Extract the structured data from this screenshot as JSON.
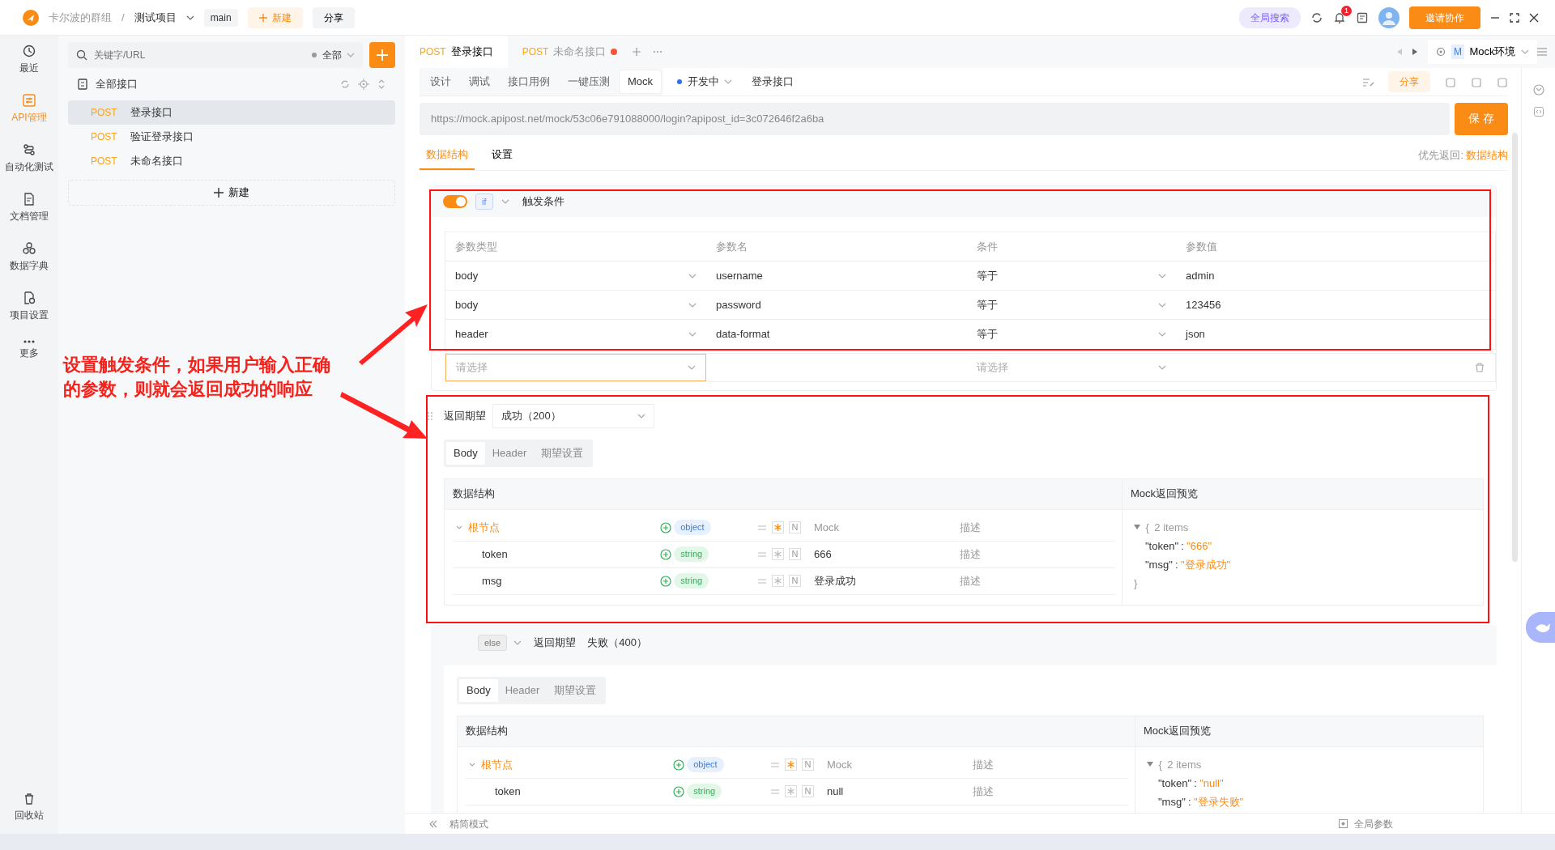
{
  "topbar": {
    "team": "卡尔波的群组",
    "separator": "/",
    "project": "测试项目",
    "branch": "main",
    "new_button": "新建",
    "share_button": "分享",
    "global_search": "全局搜索",
    "notification_count": "1",
    "invite_button": "邀请协作"
  },
  "rail": [
    {
      "label": "最近",
      "selected": false
    },
    {
      "label": "API管理",
      "selected": true
    },
    {
      "label": "自动化测试",
      "selected": false
    },
    {
      "label": "文档管理",
      "selected": false
    },
    {
      "label": "数据字典",
      "selected": false
    },
    {
      "label": "项目设置",
      "selected": false
    },
    {
      "label": "更多",
      "selected": false
    }
  ],
  "rail_bottom": {
    "label": "回收站"
  },
  "api_list": {
    "search_placeholder": "关键字/URL",
    "filter": "全部",
    "root": "全部接口",
    "new_button": "新建",
    "items": [
      {
        "method": "POST",
        "name": "登录接口",
        "selected": true
      },
      {
        "method": "POST",
        "name": "验证登录接口",
        "selected": false
      },
      {
        "method": "POST",
        "name": "未命名接口",
        "selected": false
      }
    ]
  },
  "tabs": [
    {
      "method": "POST",
      "name": "登录接口",
      "selected": true,
      "unsaved": false
    },
    {
      "method": "POST",
      "name": "未命名接口",
      "selected": false,
      "unsaved": true
    }
  ],
  "environment": {
    "badge": "M",
    "name": "Mock环境"
  },
  "subtabs": [
    {
      "label": "设计",
      "selected": false
    },
    {
      "label": "调试",
      "selected": false
    },
    {
      "label": "接口用例",
      "selected": false
    },
    {
      "label": "一键压测",
      "selected": false
    },
    {
      "label": "Mock",
      "selected": true
    }
  ],
  "status": "开发中",
  "api_name": "登录接口",
  "share": "分享",
  "url": "https://mock.apipost.net/mock/53c06e791088000/login?apipost_id=3c072646f2a6ba",
  "save_button": "保 存",
  "section_tabs": [
    {
      "label": "数据结构",
      "selected": true
    },
    {
      "label": "设置",
      "selected": false
    }
  ],
  "priority": {
    "label": "优先返回:",
    "value": "数据结构"
  },
  "condition": {
    "enabled": true,
    "keyword": "if",
    "title": "触发条件",
    "columns": [
      "参数类型",
      "参数名",
      "条件",
      "参数值"
    ],
    "rows": [
      {
        "type": "body",
        "name": "username",
        "operator": "等于",
        "value": "admin"
      },
      {
        "type": "body",
        "name": "password",
        "operator": "等于",
        "value": "123456"
      },
      {
        "type": "header",
        "name": "data-format",
        "operator": "等于",
        "value": "json"
      }
    ],
    "new_row": {
      "type_placeholder": "请选择",
      "operator_placeholder": "请选择"
    }
  },
  "expectations": [
    {
      "kind": "select",
      "label": "返回期望",
      "value": "成功（200）",
      "body_tabs": [
        {
          "label": "Body",
          "selected": true
        },
        {
          "label": "Header",
          "selected": false
        },
        {
          "label": "期望设置",
          "selected": false
        }
      ],
      "structure_title": "数据结构",
      "preview_title": "Mock返回预览",
      "fields": [
        {
          "name": "根节点",
          "type": "object",
          "required": true,
          "null_toggle": "N",
          "mock_placeholder": "Mock",
          "description_placeholder": "描述",
          "children": [
            {
              "name": "token",
              "type": "string",
              "required": false,
              "null_toggle": "N",
              "mock": "666",
              "description_placeholder": "描述"
            },
            {
              "name": "msg",
              "type": "string",
              "required": false,
              "null_toggle": "N",
              "mock": "登录成功",
              "description_placeholder": "描述"
            }
          ]
        }
      ],
      "preview": {
        "open": "{",
        "count": "2 items",
        "entries": [
          {
            "key": "\"token\"",
            "colon": ":",
            "value": "\"666\""
          },
          {
            "key": "\"msg\"",
            "colon": ":",
            "value": "\"登录成功\""
          }
        ],
        "close": "}"
      }
    },
    {
      "kind": "text",
      "keyword": "else",
      "label": "返回期望",
      "value": "失败（400）",
      "body_tabs": [
        {
          "label": "Body",
          "selected": true
        },
        {
          "label": "Header",
          "selected": false
        },
        {
          "label": "期望设置",
          "selected": false
        }
      ],
      "structure_title": "数据结构",
      "preview_title": "Mock返回预览",
      "fields": [
        {
          "name": "根节点",
          "type": "object",
          "required": true,
          "null_toggle": "N",
          "mock_placeholder": "Mock",
          "description_placeholder": "描述",
          "children": [
            {
              "name": "token",
              "type": "string",
              "required": false,
              "null_toggle": "N",
              "mock": "null",
              "description_placeholder": "描述"
            }
          ]
        }
      ],
      "preview": {
        "open": "{",
        "count": "2 items",
        "entries": [
          {
            "key": "\"token\"",
            "colon": ":",
            "value": "\"null\""
          },
          {
            "key": "\"msg\"",
            "colon": ":",
            "value": "\"登录失败\""
          }
        ]
      }
    }
  ],
  "status_bar": {
    "compact_mode": "精简模式",
    "global_params": "全局参数"
  },
  "annotation": {
    "lines": [
      "设置触发条件，如果用户输入正确",
      "的参数，则就会返回成功的响应"
    ]
  }
}
